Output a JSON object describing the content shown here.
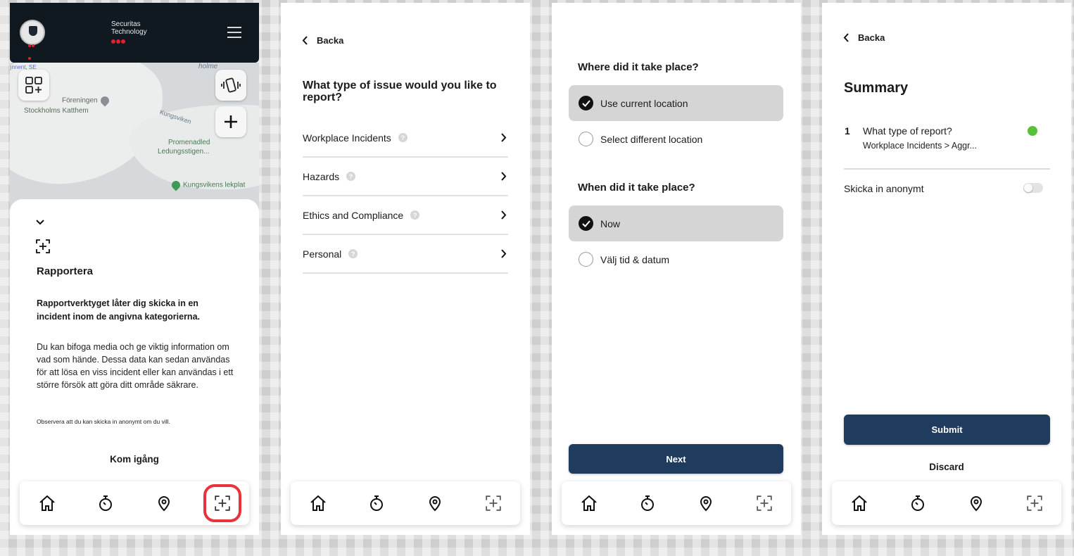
{
  "screen1": {
    "brand_line1": "Securitas",
    "brand_line2": "Technology",
    "map_labels": {
      "edge_label": "ŋnnent, SE",
      "holme": "holme",
      "foreningen_line1": "Föreningen",
      "foreningen_line2": "Stockholms Katthem",
      "kungsviken": "Kungsviken",
      "promenad_line1": "Promenadled",
      "promenad_line2": "Ledungsstigen...",
      "lekplats": "Kungsvikens lekplat"
    },
    "sheet": {
      "title": "Rapportera",
      "lead": "Rapportverktyget låter dig skicka in en incident inom de angivna kategorierna.",
      "body": "Du kan bifoga media och ge viktig information om vad som hände. Dessa data kan sedan användas för att lösa en viss incident eller kan användas i ett större försök att göra ditt område säkrare.",
      "note": "Observera att du kan skicka in anonymt om du vill.",
      "cta": "Kom igång"
    }
  },
  "screen2": {
    "back": "Backa",
    "question": "What type of issue would you like to report?",
    "items": [
      {
        "label": "Workplace Incidents",
        "badge": "?"
      },
      {
        "label": "Hazards",
        "badge": "?"
      },
      {
        "label": "Ethics and Compliance",
        "badge": "?"
      },
      {
        "label": "Personal",
        "badge": "?"
      }
    ]
  },
  "screen3": {
    "where_title": "Where did it take place?",
    "where_options": [
      "Use current location",
      "Select different location"
    ],
    "when_title": "When did it take place?",
    "when_options": [
      "Now",
      "Välj tid & datum"
    ],
    "next": "Next"
  },
  "screen4": {
    "back": "Backa",
    "title": "Summary",
    "row_number": "1",
    "row_question": "What type of report?",
    "row_answer": "Workplace Incidents > Aggr...",
    "anon_label": "Skicka in anonymt",
    "submit": "Submit",
    "discard": "Discard"
  },
  "tabbar_icons": [
    "home-icon",
    "stopwatch-icon",
    "location-pin-icon",
    "report-icon"
  ],
  "colors": {
    "primary": "#1f3c5e",
    "header_bg": "#101820",
    "highlight": "#e8323c",
    "success": "#57c13a"
  }
}
